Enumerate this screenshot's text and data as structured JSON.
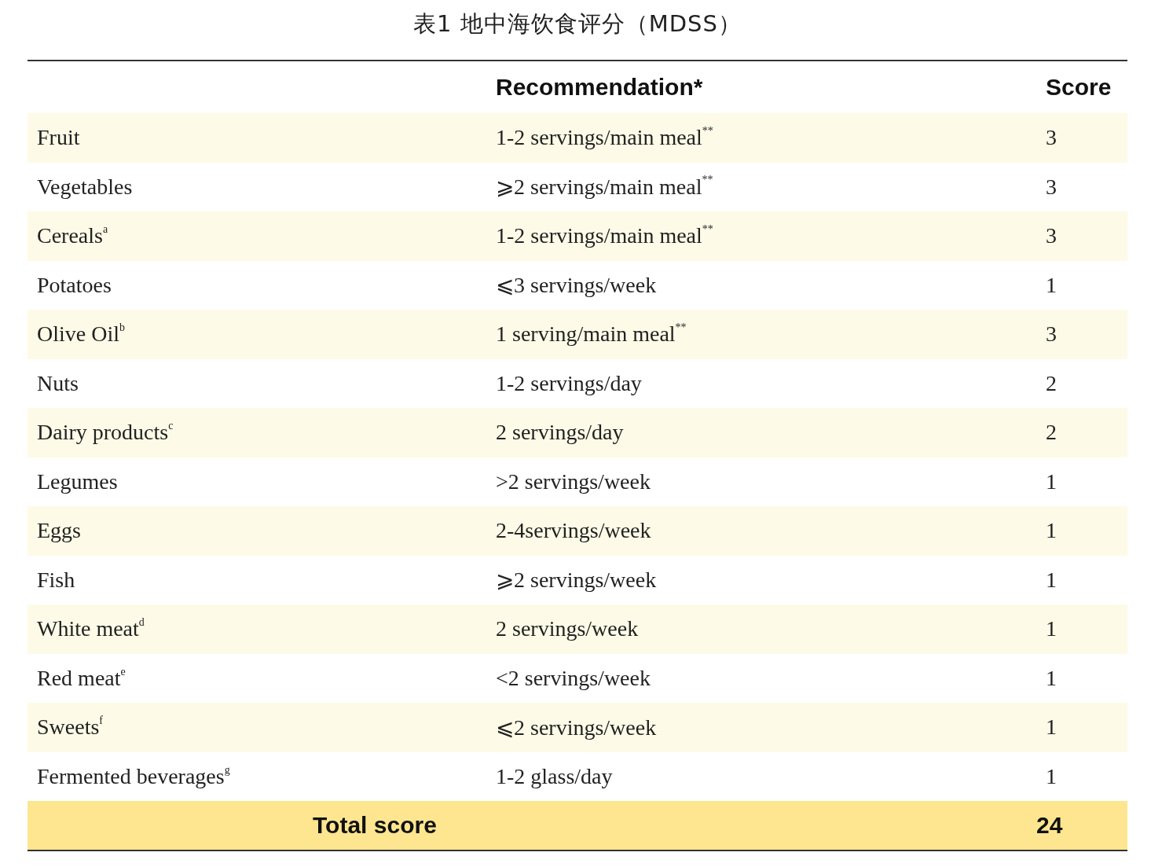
{
  "title": "表1 地中海饮食评分（MDSS）",
  "columns": [
    {
      "label": "Recommendation*"
    },
    {
      "label": "Score"
    }
  ],
  "rows": [
    {
      "food": "Fruit",
      "recommendation": "1-2 servings/main meal$^{**}$",
      "score": "3"
    },
    {
      "food": "Vegetables",
      "recommendation": "⩾2 servings/main meal$^{**}$",
      "score": "3"
    },
    {
      "food": "Cereals$^{a}$",
      "recommendation": "1-2 servings/main meal$^{**}$",
      "score": "3"
    },
    {
      "food": "Potatoes",
      "recommendation": "⩽3 servings/week",
      "score": "1"
    },
    {
      "food": "Olive Oil$^{b}$",
      "recommendation": "1 serving/main meal$^{**}$",
      "score": "3"
    },
    {
      "food": "Nuts",
      "recommendation": "1-2 servings/day",
      "score": "2"
    },
    {
      "food": "Dairy products$^{c}$",
      "recommendation": "2 servings/day",
      "score": "2"
    },
    {
      "food": "Legumes",
      "recommendation": ">2 servings/week",
      "score": "1"
    },
    {
      "food": "Eggs",
      "recommendation": "2-4servings/week",
      "score": "1"
    },
    {
      "food": "Fish",
      "recommendation": "⩾2 servings/week",
      "score": "1"
    },
    {
      "food": "White meat$^{d}$",
      "recommendation": "2 servings/week",
      "score": "1"
    },
    {
      "food": "Red meat$^{e}$",
      "recommendation": "<2 servings/week",
      "score": "1"
    },
    {
      "food": "Sweets$^{f}$",
      "recommendation": "⩽2 servings/week",
      "score": "1"
    },
    {
      "food": "Fermented beverages$^{g}$",
      "recommendation": "1-2 glass/day",
      "score": "1"
    }
  ],
  "total": {
    "label": "Total score",
    "score": "24"
  }
}
